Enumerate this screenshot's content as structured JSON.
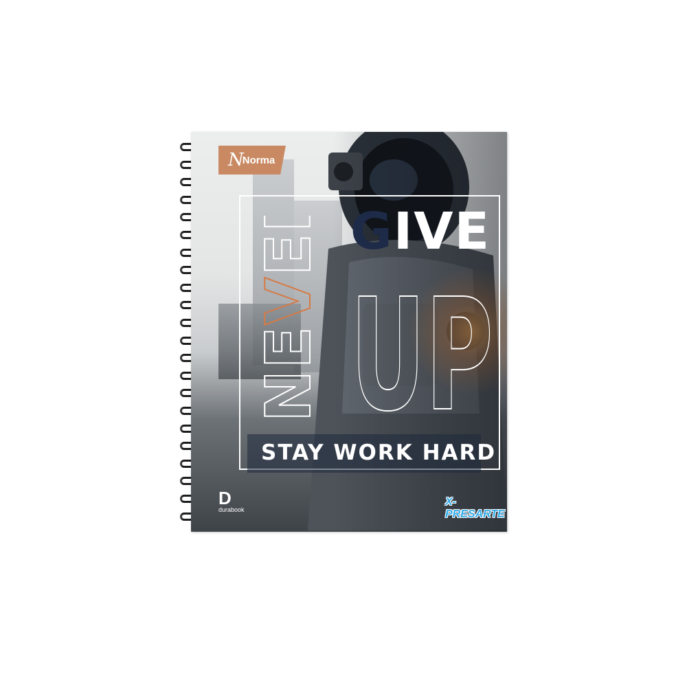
{
  "product": {
    "brand": "Norma",
    "headline_never": "NEVER",
    "headline_give": "GIVE",
    "headline_up": "UP",
    "slogan": "STAY WORK HARD",
    "sub_brand": "durabook",
    "line_logo": "X-PRESARTE"
  },
  "colors": {
    "brand_tab": "#c98a63",
    "never_accent": "#d67a45",
    "give_dark": "#1d2a48",
    "xpres": "#2fa9e8"
  }
}
